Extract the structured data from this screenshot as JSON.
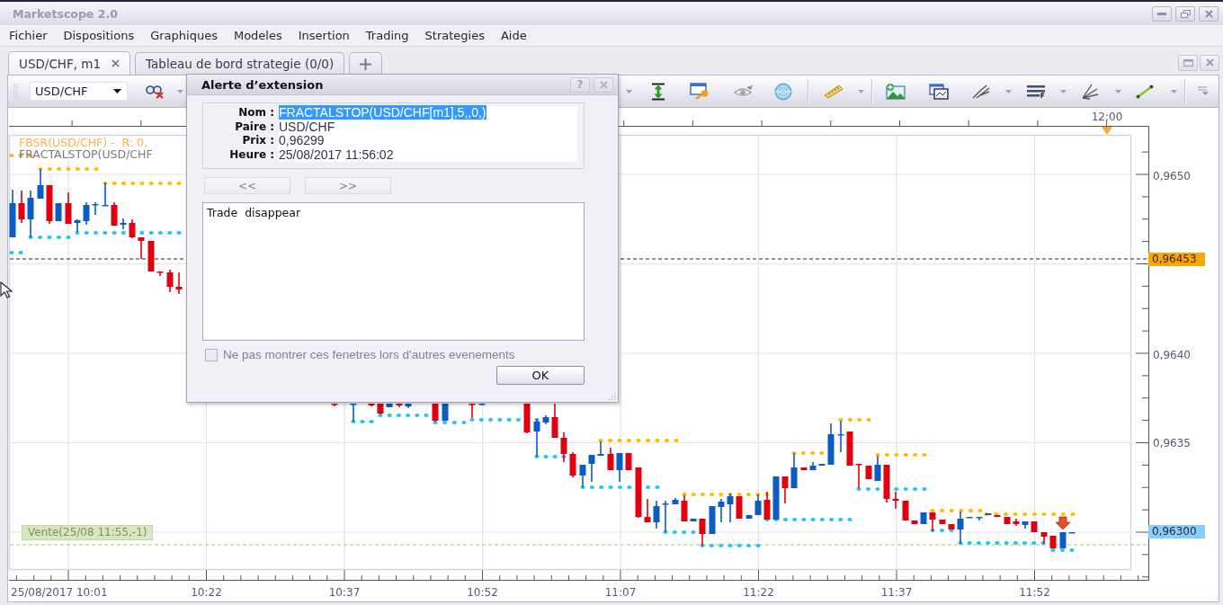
{
  "window": {
    "title": "Marketscope 2.0"
  },
  "menu": [
    "Fichier",
    "Dispositions",
    "Graphiques",
    "Modeles",
    "Insertion",
    "Trading",
    "Strategies",
    "Aide"
  ],
  "tabs": [
    {
      "label": "USD/CHF, m1",
      "selected": true,
      "closable": true
    },
    {
      "label": "Tableau de bord strategie (0/0)",
      "selected": false,
      "closable": false
    }
  ],
  "toolbar": {
    "symbol": "USD/CHF"
  },
  "chart": {
    "legend": [
      {
        "text": "FBSR(USD/CHF) -  R: 0,",
        "color": "#ffb347"
      },
      {
        "text": "FRACTALSTOP(USD/CHF",
        "color": "#7a7a7a"
      }
    ],
    "time_marker": "12:00",
    "x_labels": [
      "25/08/2017 10:01",
      "10:22",
      "10:37",
      "10:52",
      "11:07",
      "11:22",
      "11:37",
      "11:52"
    ],
    "y_labels": [
      "0,9650",
      "0,9640",
      "0,9635"
    ],
    "price_markers": [
      {
        "label": "0,96453",
        "color": "#ffa500"
      },
      {
        "label": "0,96300",
        "color": "#87cefa"
      }
    ],
    "trade_label": "Vente(25/08 11:55,-1)"
  },
  "dialog": {
    "title": "Alerte d’extension",
    "help_button": "?",
    "fields": [
      {
        "label": "Nom :",
        "value": "FRACTALSTOP(USD/CHF[m1],5,,0,)",
        "selected": true
      },
      {
        "label": "Paire :",
        "value": "USD/CHF",
        "selected": false
      },
      {
        "label": "Prix :",
        "value": "0,96299",
        "selected": false
      },
      {
        "label": "Heure :",
        "value": "25/08/2017 11:56:02",
        "selected": false
      }
    ],
    "nav_buttons": [
      {
        "label": "<<",
        "disabled": true
      },
      {
        "label": ">>",
        "disabled": true
      }
    ],
    "message": "Trade  disappear",
    "checkbox": {
      "label": "Ne pas montrer ces fenetres lors d'autres evenements",
      "checked": false,
      "disabled": true
    },
    "ok_button": "OK"
  }
}
